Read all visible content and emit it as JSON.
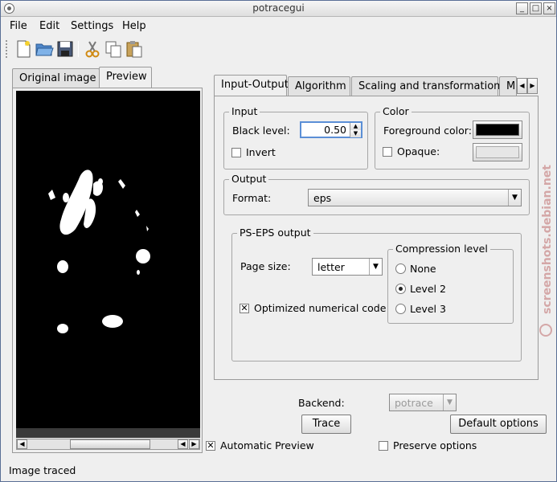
{
  "window": {
    "title": "potracegui"
  },
  "menu": [
    "File",
    "Edit",
    "Settings",
    "Help"
  ],
  "toolbar": {
    "icons": [
      "new-file-icon",
      "open-folder-icon",
      "save-icon",
      "cut-icon",
      "copy-icon",
      "paste-icon"
    ]
  },
  "left_tabs": [
    "Original image",
    "Preview"
  ],
  "right_tabs": [
    "Input-Output",
    "Algorithm",
    "Scaling and transformations",
    "M"
  ],
  "input": {
    "label": "Input",
    "black_level_label": "Black level:",
    "black_level_value": "0.50",
    "invert_label": "Invert"
  },
  "color": {
    "label": "Color",
    "foreground_label": "Foreground color:",
    "foreground_value": "#000000",
    "opaque_label": "Opaque:",
    "opaque_value": "#e6e6e6"
  },
  "output": {
    "label": "Output",
    "format_label": "Format:",
    "format_value": "eps"
  },
  "ps_eps": {
    "label": "PS-EPS output",
    "page_size_label": "Page size:",
    "page_size_value": "letter",
    "optimized_label": "Optimized numerical code",
    "compression": {
      "label": "Compression level",
      "options": [
        "None",
        "Level 2",
        "Level 3"
      ],
      "selected": "Level 2"
    }
  },
  "backend": {
    "label": "Backend:",
    "value": "potrace"
  },
  "buttons": {
    "trace": "Trace",
    "default_options": "Default options"
  },
  "automatic_preview": {
    "label": "Automatic Preview",
    "checked": true
  },
  "preserve_options": {
    "label": "Preserve options",
    "checked": false
  },
  "status": "Image traced",
  "watermark": "screenshots.debian.net"
}
